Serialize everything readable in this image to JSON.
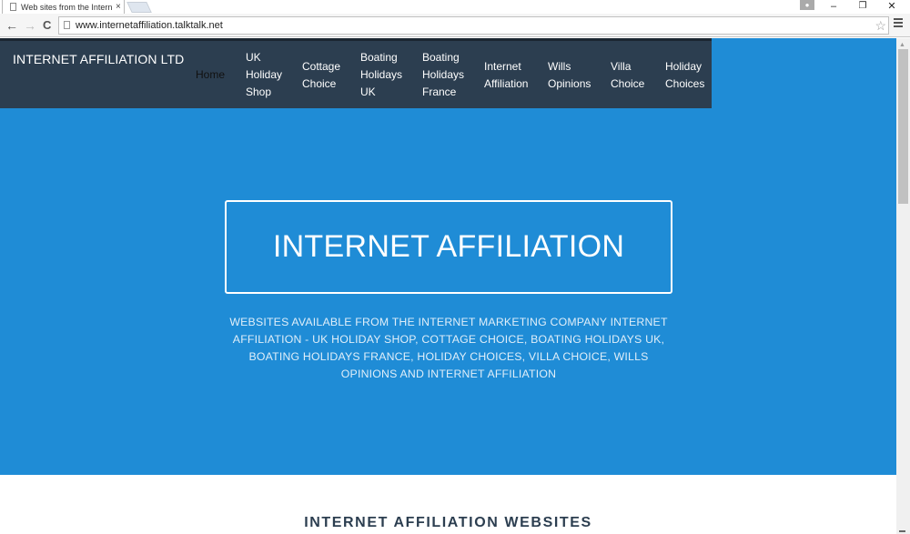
{
  "browser": {
    "tab_title": "Web sites from the Interne",
    "tab_close": "×",
    "url": "www.internetaffiliation.talktalk.net",
    "icons": {
      "back": "←",
      "forward": "→",
      "reload": "C",
      "star": "☆",
      "minimize": "–",
      "restore": "❐",
      "close": "✕",
      "user": "👤"
    }
  },
  "navbar": {
    "brand": "INTERNET AFFILIATION LTD",
    "items": [
      {
        "lines": [
          "Home"
        ],
        "active": true
      },
      {
        "lines": [
          "UK",
          "Holiday",
          "Shop"
        ]
      },
      {
        "lines": [
          "Cottage",
          "Choice"
        ]
      },
      {
        "lines": [
          "Boating",
          "Holidays",
          "UK"
        ]
      },
      {
        "lines": [
          "Boating",
          "Holidays",
          "France"
        ]
      },
      {
        "lines": [
          "Internet",
          "Affiliation"
        ]
      },
      {
        "lines": [
          "Wills",
          "Opinions"
        ]
      },
      {
        "lines": [
          "Villa",
          "Choice"
        ]
      },
      {
        "lines": [
          "Holiday",
          "Choices"
        ]
      }
    ]
  },
  "hero": {
    "title": "INTERNET AFFILIATION",
    "tagline": "WEBSITES AVAILABLE FROM THE INTERNET MARKETING COMPANY INTERNET AFFILIATION - UK HOLIDAY SHOP, COTTAGE CHOICE, BOATING HOLIDAYS UK, BOATING HOLIDAYS FRANCE, HOLIDAY CHOICES, VILLA CHOICE, WILLS OPINIONS AND INTERNET AFFILIATION"
  },
  "section": {
    "title": "INTERNET AFFILIATION WEBSITES"
  },
  "colors": {
    "navbar_bg": "#2c3e50",
    "hero_bg": "#1f8cd6",
    "section_title": "#2c3e50"
  }
}
